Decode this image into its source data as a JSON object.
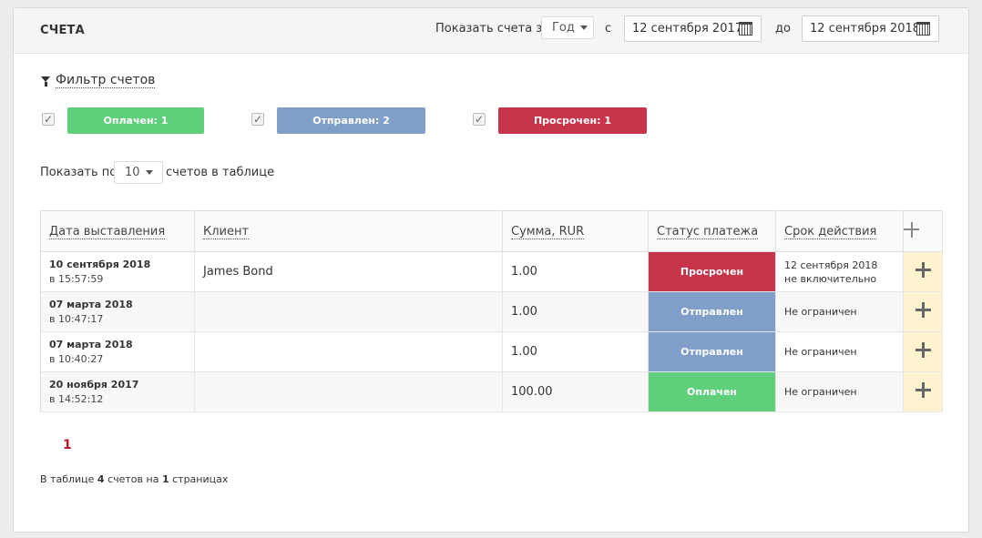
{
  "header": {
    "title": "СЧЕТА",
    "period_label": "Показать счета за:",
    "period_value": "Год",
    "from_label": "с",
    "from_date": "12 сентября 2017",
    "to_label": "до",
    "to_date": "12 сентября 2018"
  },
  "filter": {
    "toggle_label": "Фильтр счетов",
    "items": [
      {
        "label": "Оплачен: 1",
        "checked": true,
        "color": "#5fcf7b"
      },
      {
        "label": "Отправлен: 2",
        "checked": true,
        "color": "#7f9fc8"
      },
      {
        "label": "Просрочен: 1",
        "checked": true,
        "color": "#c8354a"
      }
    ]
  },
  "paging_select": {
    "prefix": "Показать по:",
    "value": "10",
    "suffix": "счетов в таблице"
  },
  "table": {
    "columns": [
      "Дата выставления",
      "Клиент",
      "Сумма, RUR",
      "Статус платежа",
      "Срок действия"
    ],
    "rows": [
      {
        "date": "10 сентября 2018",
        "time": "в 15:57:59",
        "client": "James Bond",
        "sum": "1.00",
        "status": "Просрочен",
        "status_color": "#c8354a",
        "validity_1": "12 сентября 2018",
        "validity_2": "не включительно"
      },
      {
        "date": "07 марта 2018",
        "time": "в 10:47:17",
        "client": "",
        "sum": "1.00",
        "status": "Отправлен",
        "status_color": "#7f9fc8",
        "validity_1": "Не ограничен",
        "validity_2": ""
      },
      {
        "date": "07 марта 2018",
        "time": "в 10:40:27",
        "client": "",
        "sum": "1.00",
        "status": "Отправлен",
        "status_color": "#7f9fc8",
        "validity_1": "Не ограничен",
        "validity_2": ""
      },
      {
        "date": "20 ноября 2017",
        "time": "в 14:52:12",
        "client": "",
        "sum": "100.00",
        "status": "Оплачен",
        "status_color": "#5fcf7b",
        "validity_1": "Не ограничен",
        "validity_2": ""
      }
    ]
  },
  "pagination": {
    "current_page": "1"
  },
  "summary": {
    "prefix": "В таблице",
    "count": "4",
    "middle": "счетов на",
    "pages": "1",
    "suffix": "страницах"
  }
}
